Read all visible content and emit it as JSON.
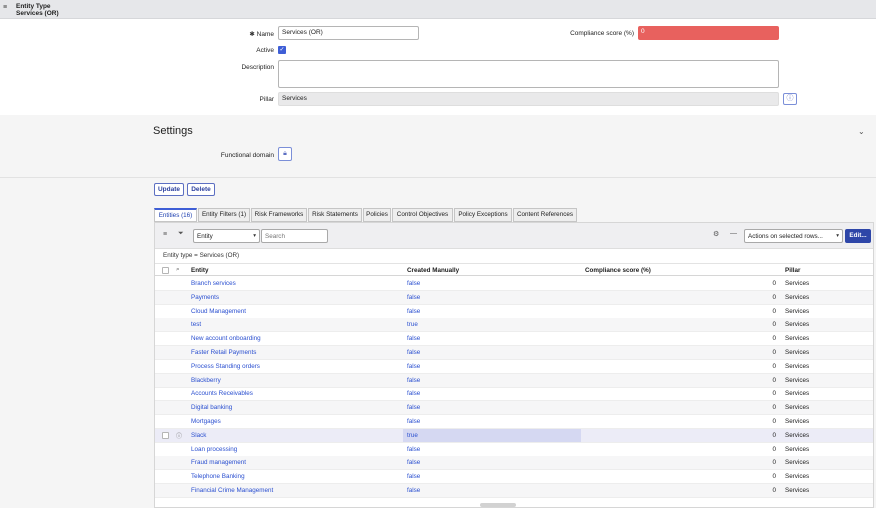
{
  "header": {
    "record_type": "Entity Type",
    "record_name": "Services (OR)"
  },
  "form": {
    "name_label": "Name",
    "name_value": "Services (OR)",
    "active_label": "Active",
    "description_label": "Description",
    "description_value": "",
    "pillar_label": "Pillar",
    "pillar_value": "Services",
    "compliance_label": "Compliance score (%)",
    "compliance_value": "0"
  },
  "settings": {
    "title": "Settings",
    "functional_domain_label": "Functional domain"
  },
  "actions": {
    "update": "Update",
    "delete": "Delete"
  },
  "tabs": [
    {
      "label": "Entities (16)"
    },
    {
      "label": "Entity Filters (1)"
    },
    {
      "label": "Risk Frameworks"
    },
    {
      "label": "Risk Statements"
    },
    {
      "label": "Policies"
    },
    {
      "label": "Control Objectives"
    },
    {
      "label": "Policy Exceptions"
    },
    {
      "label": "Content References"
    }
  ],
  "list": {
    "search_field": "Entity",
    "search_placeholder": "Search",
    "actions_select": "Actions on selected rows...",
    "edit_button": "Edit...",
    "filter_breadcrumb": "Entity type = Services (OR)",
    "columns": {
      "entity": "Entity",
      "created": "Created Manually",
      "score": "Compliance score (%)",
      "pillar": "Pillar"
    },
    "rows": [
      {
        "entity": "Branch services",
        "created": "false",
        "score": "0",
        "pillar": "Services"
      },
      {
        "entity": "Payments",
        "created": "false",
        "score": "0",
        "pillar": "Services"
      },
      {
        "entity": "Cloud Management",
        "created": "false",
        "score": "0",
        "pillar": "Services"
      },
      {
        "entity": "test",
        "created": "true",
        "score": "0",
        "pillar": "Services"
      },
      {
        "entity": "New account onboarding",
        "created": "false",
        "score": "0",
        "pillar": "Services"
      },
      {
        "entity": "Faster Retail Payments",
        "created": "false",
        "score": "0",
        "pillar": "Services"
      },
      {
        "entity": "Process Standing orders",
        "created": "false",
        "score": "0",
        "pillar": "Services"
      },
      {
        "entity": "Blackberry",
        "created": "false",
        "score": "0",
        "pillar": "Services"
      },
      {
        "entity": "Accounts Receivables",
        "created": "false",
        "score": "0",
        "pillar": "Services"
      },
      {
        "entity": "Digital banking",
        "created": "false",
        "score": "0",
        "pillar": "Services"
      },
      {
        "entity": "Mortgages",
        "created": "false",
        "score": "0",
        "pillar": "Services"
      },
      {
        "entity": "Slack",
        "created": "true",
        "score": "0",
        "pillar": "Services"
      },
      {
        "entity": "Loan processing",
        "created": "false",
        "score": "0",
        "pillar": "Services"
      },
      {
        "entity": "Fraud management",
        "created": "false",
        "score": "0",
        "pillar": "Services"
      },
      {
        "entity": "Telephone Banking",
        "created": "false",
        "score": "0",
        "pillar": "Services"
      },
      {
        "entity": "Financial Crime Management",
        "created": "false",
        "score": "0",
        "pillar": "Services"
      }
    ]
  },
  "colors": {
    "accent": "#3e5ed6",
    "score_low": "#e8615e",
    "link": "#2a4fd0"
  }
}
